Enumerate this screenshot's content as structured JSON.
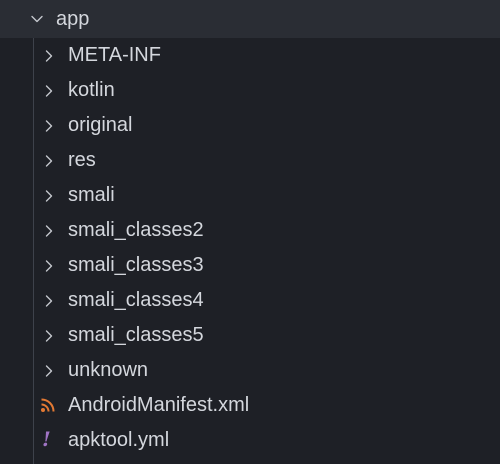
{
  "root": {
    "label": "app",
    "icon": "chevron-down-icon",
    "expanded": true
  },
  "items": [
    {
      "label": "META-INF",
      "kind": "folder",
      "icon": "chevron-right-icon"
    },
    {
      "label": "kotlin",
      "kind": "folder",
      "icon": "chevron-right-icon"
    },
    {
      "label": "original",
      "kind": "folder",
      "icon": "chevron-right-icon"
    },
    {
      "label": "res",
      "kind": "folder",
      "icon": "chevron-right-icon"
    },
    {
      "label": "smali",
      "kind": "folder",
      "icon": "chevron-right-icon"
    },
    {
      "label": "smali_classes2",
      "kind": "folder",
      "icon": "chevron-right-icon"
    },
    {
      "label": "smali_classes3",
      "kind": "folder",
      "icon": "chevron-right-icon"
    },
    {
      "label": "smali_classes4",
      "kind": "folder",
      "icon": "chevron-right-icon"
    },
    {
      "label": "smali_classes5",
      "kind": "folder",
      "icon": "chevron-right-icon"
    },
    {
      "label": "unknown",
      "kind": "folder",
      "icon": "chevron-right-icon"
    },
    {
      "label": "AndroidManifest.xml",
      "kind": "file",
      "icon": "rss-xml-icon"
    },
    {
      "label": "apktool.yml",
      "kind": "file",
      "icon": "exclamation-yml-icon"
    }
  ],
  "colors": {
    "background": "#1e2026",
    "selected_row": "#2a2d34",
    "text": "#d4d7dd",
    "chevron": "#c5c8ce",
    "xml_icon": "#e37933",
    "yml_icon": "#a074c4"
  }
}
